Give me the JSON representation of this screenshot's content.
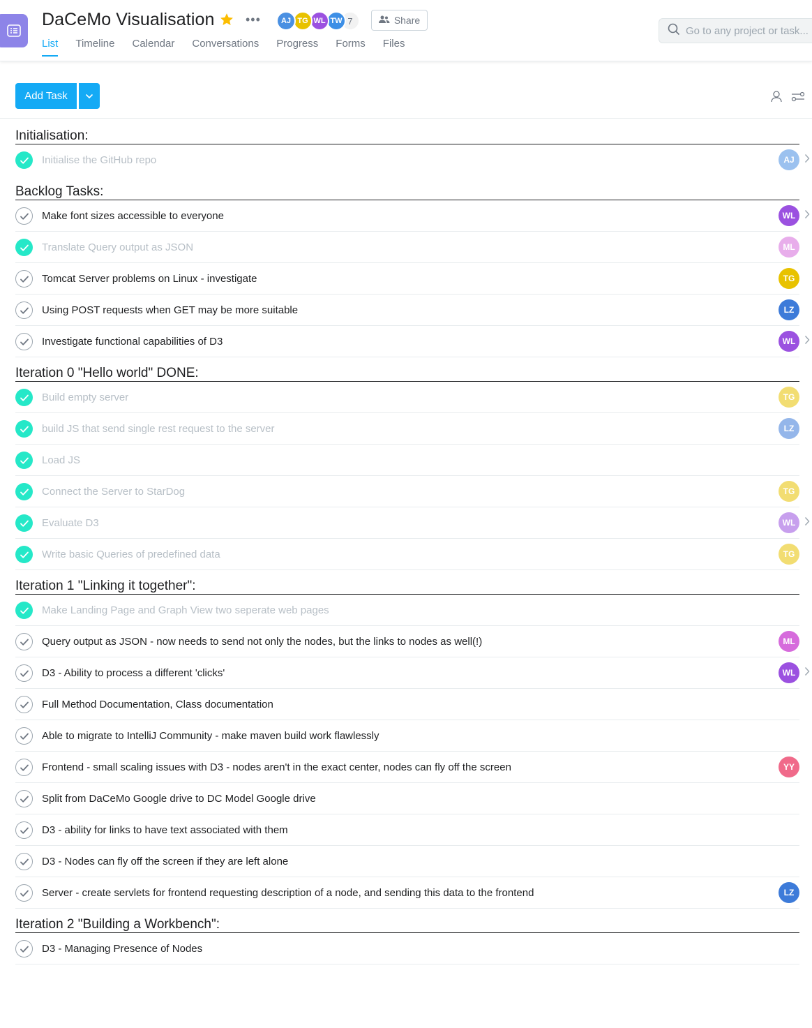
{
  "project": {
    "title": "DaCeMo Visualisation",
    "more": "•••",
    "members": [
      "AJ",
      "TG",
      "WL",
      "TW"
    ],
    "member_count": "7",
    "share_label": "Share"
  },
  "tabs": [
    "List",
    "Timeline",
    "Calendar",
    "Conversations",
    "Progress",
    "Forms",
    "Files"
  ],
  "search": {
    "placeholder": "Go to any project or task..."
  },
  "toolbar": {
    "add_task_label": "Add Task"
  },
  "colors": {
    "accent": "#14aaf5",
    "done_check": "#25e8c8",
    "project_icon": "#8d84e8",
    "star": "#fcbd01"
  },
  "avatar_colors": {
    "AJ": "#4a90e2",
    "TG": "#e8c200",
    "WL": "#9b51e0",
    "TW": "#3d8fe6",
    "ML": "#d66bdc",
    "LZ": "#3d7bd9",
    "YY": "#f06a8a"
  },
  "sections": [
    {
      "title": "Initialisation:",
      "tasks": [
        {
          "name": "Initialise the GitHub repo",
          "done": true,
          "assignee": "AJ",
          "chevron": true
        }
      ]
    },
    {
      "title": "Backlog Tasks:",
      "tasks": [
        {
          "name": "Make font sizes accessible to everyone",
          "done": false,
          "assignee": "WL",
          "chevron": true
        },
        {
          "name": "Translate Query output as JSON",
          "done": true,
          "assignee": "ML",
          "chevron": false
        },
        {
          "name": "Tomcat Server problems on Linux - investigate",
          "done": false,
          "assignee": "TG",
          "chevron": false
        },
        {
          "name": "Using POST requests when GET may be more suitable",
          "done": false,
          "assignee": "LZ",
          "chevron": false
        },
        {
          "name": "Investigate functional capabilities of D3",
          "done": false,
          "assignee": "WL",
          "chevron": true
        }
      ]
    },
    {
      "title": "Iteration 0 \"Hello world\" DONE:",
      "tasks": [
        {
          "name": "Build empty server",
          "done": true,
          "assignee": "TG",
          "chevron": false
        },
        {
          "name": "build JS that send single rest request to the server",
          "done": true,
          "assignee": "LZ",
          "chevron": false
        },
        {
          "name": "Load JS",
          "done": true,
          "assignee": "",
          "chevron": false
        },
        {
          "name": "Connect the Server to StarDog",
          "done": true,
          "assignee": "TG",
          "chevron": false
        },
        {
          "name": "Evaluate D3",
          "done": true,
          "assignee": "WL",
          "chevron": true
        },
        {
          "name": "Write basic Queries of predefined data",
          "done": true,
          "assignee": "TG",
          "chevron": false
        }
      ]
    },
    {
      "title": "Iteration 1 \"Linking it together\":",
      "tasks": [
        {
          "name": "Make Landing Page and Graph View two seperate web pages",
          "done": true,
          "assignee": "",
          "chevron": false
        },
        {
          "name": "Query output as JSON - now needs to send not only the nodes, but the links to nodes as well(!)",
          "done": false,
          "assignee": "ML",
          "chevron": false
        },
        {
          "name": "D3 - Ability to process a different 'clicks'",
          "done": false,
          "assignee": "WL",
          "chevron": true
        },
        {
          "name": "Full Method Documentation, Class documentation",
          "done": false,
          "assignee": "",
          "chevron": false
        },
        {
          "name": "Able to migrate to IntelliJ Community - make maven build work flawlessly",
          "done": false,
          "assignee": "",
          "chevron": false
        },
        {
          "name": "Frontend - small scaling issues with D3 - nodes aren't in the exact center, nodes can fly off the screen",
          "done": false,
          "assignee": "YY",
          "chevron": false
        },
        {
          "name": "Split from DaCeMo Google drive to DC Model Google drive",
          "done": false,
          "assignee": "",
          "chevron": false
        },
        {
          "name": "D3 - ability for links to have text associated with them",
          "done": false,
          "assignee": "",
          "chevron": false
        },
        {
          "name": "D3 - Nodes can fly off the screen if they are left alone",
          "done": false,
          "assignee": "",
          "chevron": false
        },
        {
          "name": "Server - create servlets for frontend requesting description of a node, and sending this data to the frontend",
          "done": false,
          "assignee": "LZ",
          "chevron": false
        }
      ]
    },
    {
      "title": "Iteration 2 \"Building a Workbench\":",
      "tasks": [
        {
          "name": "D3 - Managing Presence of Nodes",
          "done": false,
          "assignee": "",
          "chevron": false
        }
      ]
    }
  ]
}
